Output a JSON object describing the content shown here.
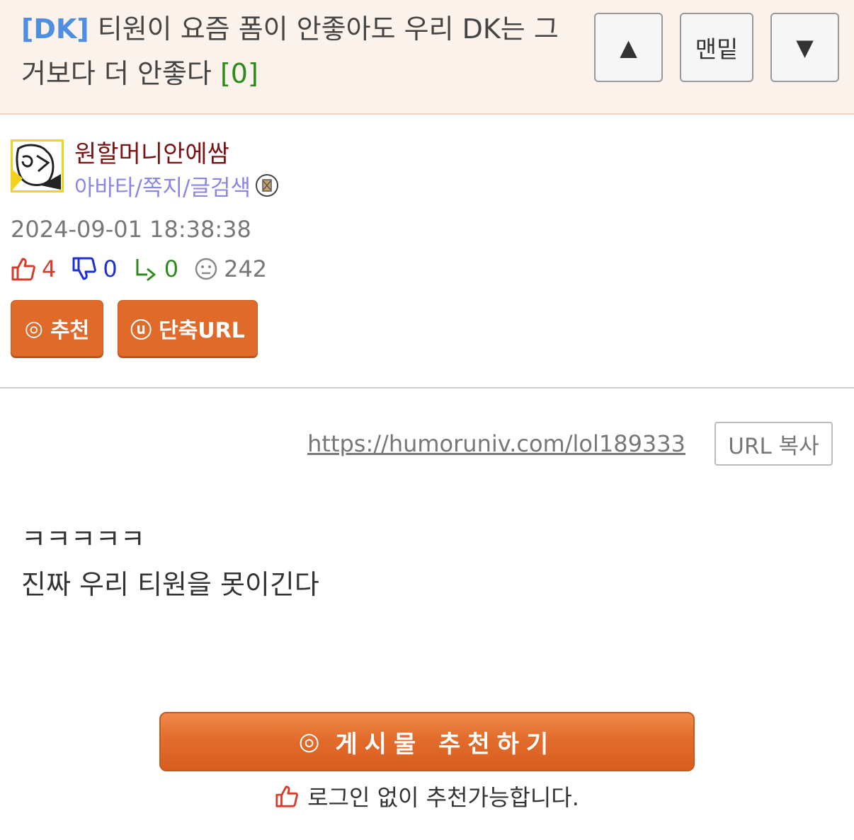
{
  "header": {
    "tag": "[DK]",
    "title": "티원이 요즘 폼이 안좋아도 우리 DK는 그거보다 더 안좋다",
    "comment_count": "[0]",
    "nav_up": "▲",
    "nav_bottom": "맨밑",
    "nav_down": "▼"
  },
  "author": {
    "nickname": "원할머니안에쌈",
    "links": "아바타/쪽지/글검색",
    "avatar_icon": "avatar-sketch-icon",
    "badge_icon": "member-badge-icon"
  },
  "post": {
    "date": "2024-09-01 18:38:38",
    "stats": {
      "recommend": "4",
      "not_recommend": "0",
      "replies": "0",
      "views": "242"
    },
    "recommend_button": "추천",
    "shorturl_button": "단축URL",
    "url": "https://humoruniv.com/lol189333",
    "url_copy_button": "URL 복사",
    "body_lines": [
      "ㅋㅋㅋㅋㅋ",
      "진짜 우리 티원을 못이긴다"
    ]
  },
  "footer": {
    "recommend_post_button": "게시물 추천하기",
    "login_note": "로그인 없이 추천가능합니다."
  },
  "colors": {
    "header_bg": "#fbf2ec",
    "tag": "#4f8fe0",
    "comment_count": "#2c8a1c",
    "nickname": "#7a1414",
    "links": "#8a86e6",
    "button_orange": "#e06a2a",
    "recommend_red": "#d93b2b",
    "not_recommend_blue": "#1d2fd0",
    "reply_green": "#2f8a1c"
  }
}
